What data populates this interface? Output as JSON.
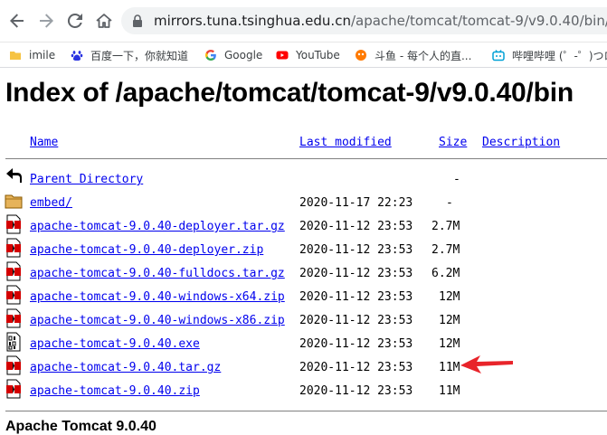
{
  "browser": {
    "url_host": "mirrors.tuna.tsinghua.edu.cn",
    "url_path": "/apache/tomcat/tomcat-9/v9.0.40/bin/",
    "bookmarks": [
      {
        "label": "imile",
        "icon": "folder-icon"
      },
      {
        "label": "百度一下，你就知道",
        "icon": "baidu-paw-icon"
      },
      {
        "label": "Google",
        "icon": "google-icon"
      },
      {
        "label": "YouTube",
        "icon": "youtube-icon"
      },
      {
        "label": "斗鱼 - 每个人的直...",
        "icon": "douyu-icon"
      },
      {
        "label": "哔哩哔哩 (゜-゜)つロ...",
        "icon": "bilibili-icon"
      }
    ]
  },
  "page": {
    "title": "Index of /apache/tomcat/tomcat-9/v9.0.40/bin",
    "headers": {
      "name": "Name",
      "modified": "Last modified",
      "size": "Size",
      "description": "Description"
    },
    "rows": [
      {
        "name": "Parent Directory",
        "modified": "",
        "size": "-",
        "icon": "back-arrow-icon"
      },
      {
        "name": "embed/",
        "modified": "2020-11-17 22:23",
        "size": "-",
        "icon": "folder-icon"
      },
      {
        "name": "apache-tomcat-9.0.40-deployer.tar.gz",
        "modified": "2020-11-12 23:53",
        "size": "2.7M",
        "icon": "compressed-file-icon"
      },
      {
        "name": "apache-tomcat-9.0.40-deployer.zip",
        "modified": "2020-11-12 23:53",
        "size": "2.7M",
        "icon": "compressed-file-icon"
      },
      {
        "name": "apache-tomcat-9.0.40-fulldocs.tar.gz",
        "modified": "2020-11-12 23:53",
        "size": "6.2M",
        "icon": "compressed-file-icon"
      },
      {
        "name": "apache-tomcat-9.0.40-windows-x64.zip",
        "modified": "2020-11-12 23:53",
        "size": "12M",
        "icon": "compressed-file-icon"
      },
      {
        "name": "apache-tomcat-9.0.40-windows-x86.zip",
        "modified": "2020-11-12 23:53",
        "size": "12M",
        "icon": "compressed-file-icon"
      },
      {
        "name": "apache-tomcat-9.0.40.exe",
        "modified": "2020-11-12 23:53",
        "size": "12M",
        "icon": "binary-file-icon"
      },
      {
        "name": "apache-tomcat-9.0.40.tar.gz",
        "modified": "2020-11-12 23:53",
        "size": "11M",
        "icon": "compressed-file-icon"
      },
      {
        "name": "apache-tomcat-9.0.40.zip",
        "modified": "2020-11-12 23:53",
        "size": "11M",
        "icon": "compressed-file-icon"
      }
    ],
    "footer": "Apache Tomcat 9.0.40"
  },
  "colors": {
    "link": "#0000ee",
    "annotation_arrow": "#e8242a"
  }
}
